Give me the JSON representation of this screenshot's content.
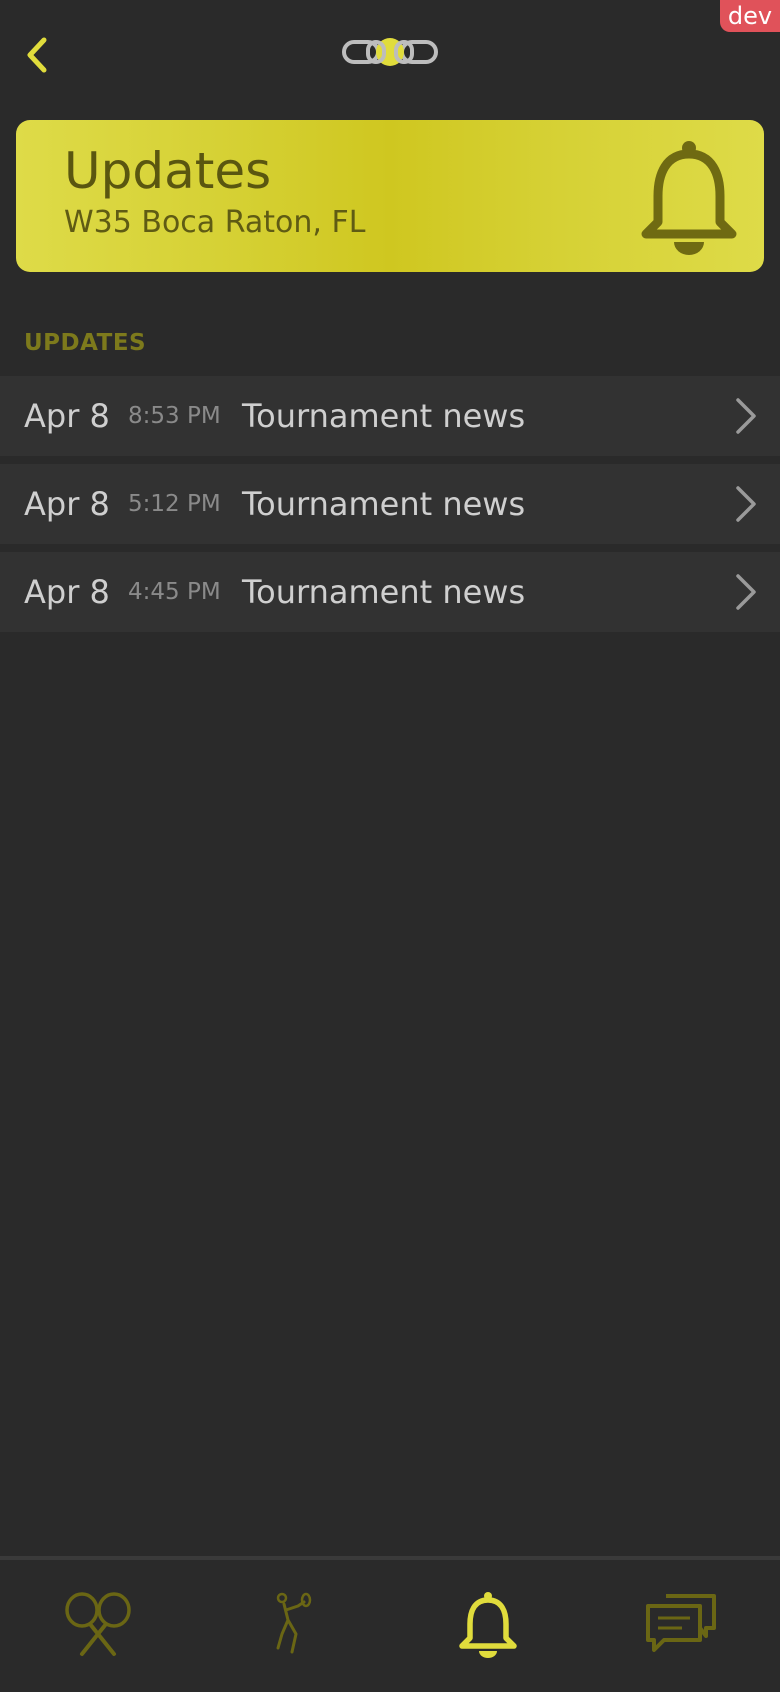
{
  "badge": {
    "label": "dev",
    "color": "#e0525a"
  },
  "top_bar": {
    "back_icon": "chevron-left-icon",
    "logo_icon": "chain-tennis-ball-logo"
  },
  "hero": {
    "title": "Updates",
    "subtitle": "W35 Boca Raton, FL",
    "icon": "bell-icon",
    "background_color": "#d5d033"
  },
  "section": {
    "label": "UPDATES"
  },
  "updates": [
    {
      "date": "Apr 8",
      "time": "8:53 PM",
      "title": "Tournament news"
    },
    {
      "date": "Apr 8",
      "time": "5:12 PM",
      "title": "Tournament news"
    },
    {
      "date": "Apr 8",
      "time": "4:45 PM",
      "title": "Tournament news"
    }
  ],
  "tab_bar": {
    "tabs": [
      {
        "icon": "tennis-rackets-icon",
        "active": false
      },
      {
        "icon": "tennis-player-icon",
        "active": false
      },
      {
        "icon": "bell-icon",
        "active": true
      },
      {
        "icon": "chat-bubbles-icon",
        "active": false
      }
    ],
    "active_color": "#e0dc3c",
    "inactive_color": "#6a6614"
  }
}
